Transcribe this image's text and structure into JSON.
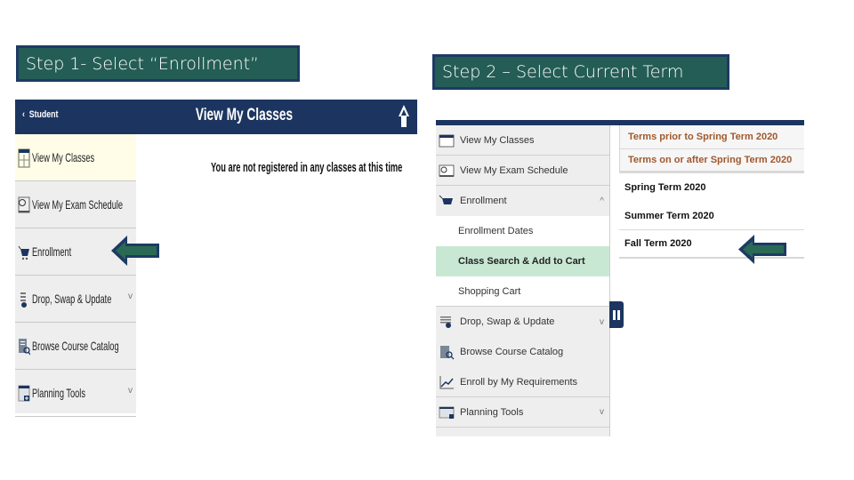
{
  "step1": {
    "label": "Step 1- Select “Enrollment”"
  },
  "step2": {
    "label": "Step 2 – Select Current Term"
  },
  "panel1": {
    "header": {
      "back_label": "Student",
      "back_icon": "chevron-left-icon",
      "title": "View My Classes",
      "home_icon": "home-icon"
    },
    "message": "You are not registered in any classes at this time",
    "sidebar": [
      {
        "label": "View My Classes",
        "icon": "calendar-icon",
        "active": true
      },
      {
        "label": "View My Exam Schedule",
        "icon": "exam-schedule-icon"
      },
      {
        "label": "Enrollment",
        "icon": "cart-icon",
        "pointed": true
      },
      {
        "label": "Drop, Swap & Update",
        "icon": "drop-swap-icon",
        "expandable": true
      },
      {
        "label": "Browse Course Catalog",
        "icon": "catalog-icon"
      },
      {
        "label": "Planning Tools",
        "icon": "planning-icon",
        "expandable": true
      }
    ],
    "chevron_down": "v"
  },
  "panel2": {
    "sidebar": [
      {
        "label": "View My Classes",
        "icon": "calendar-icon"
      },
      {
        "label": "View My Exam Schedule",
        "icon": "exam-schedule-icon"
      },
      {
        "label": "Enrollment",
        "icon": "cart-icon",
        "expanded": true
      },
      {
        "label": "Drop, Swap & Update",
        "icon": "drop-swap-icon",
        "expandable": true
      },
      {
        "label": "Browse Course Catalog",
        "icon": "catalog-icon"
      },
      {
        "label": "Enroll by My Requirements",
        "icon": "chart-line-icon"
      },
      {
        "label": "Planning Tools",
        "icon": "planning-icon",
        "expandable": true
      }
    ],
    "enrollment_subitems": [
      {
        "label": "Enrollment Dates"
      },
      {
        "label": "Class Search & Add to Cart",
        "selected": true
      },
      {
        "label": "Shopping Cart"
      }
    ],
    "chevron_up": "^",
    "chevron_down": "v",
    "term_headers": [
      {
        "label": "Terms prior to Spring Term 2020"
      },
      {
        "label": "Terms on or after Spring Term 2020"
      }
    ],
    "terms": [
      {
        "label": "Spring Term 2020"
      },
      {
        "label": "Summer Term 2020"
      },
      {
        "label": "Fall Term 2020",
        "pointed": true
      }
    ]
  },
  "colors": {
    "step_box_bg": "#245d55",
    "step_box_border": "#1e3a63",
    "header_navy": "#1c3560",
    "active_item_bg": "#fffde7",
    "selected_subitem_bg": "#c9e8d4",
    "term_header_text": "#a0582d",
    "arrow_fill": "#2a6a55",
    "arrow_border": "#1e3a63"
  }
}
